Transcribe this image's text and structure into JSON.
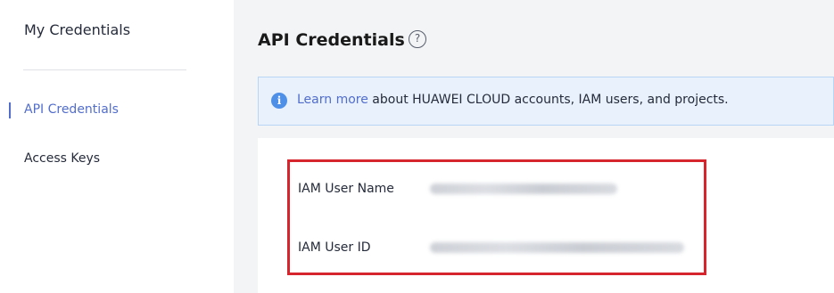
{
  "sidebar": {
    "title": "My Credentials",
    "items": [
      {
        "label": "API Credentials",
        "active": true
      },
      {
        "label": "Access Keys",
        "active": false
      }
    ]
  },
  "main": {
    "title": "API Credentials",
    "help_icon": "question-circle-icon",
    "info": {
      "icon": "info-circle-icon",
      "link_text": "Learn more",
      "text": " about HUAWEI CLOUD accounts, IAM users, and projects."
    },
    "fields": [
      {
        "label": "IAM User Name",
        "value_obscured": true
      },
      {
        "label": "IAM User ID",
        "value_obscured": true
      }
    ]
  },
  "colors": {
    "accent": "#526ecc",
    "info_background": "#e8f1fc",
    "info_icon": "#4e8fe7",
    "highlight_border": "#d6252c",
    "main_background": "#f3f4f6"
  }
}
